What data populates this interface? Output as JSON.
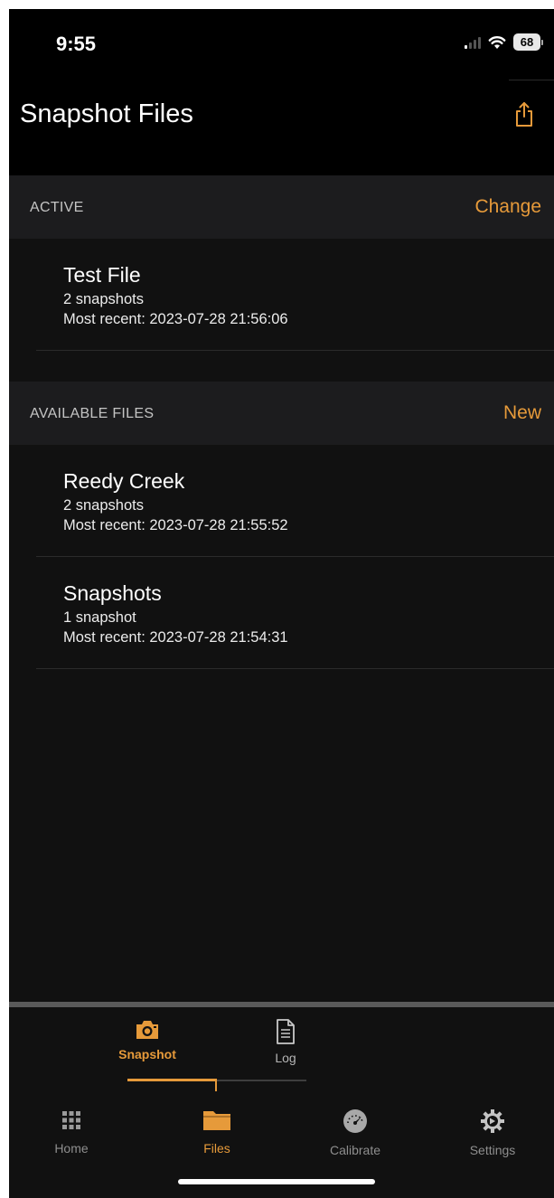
{
  "status_bar": {
    "time": "9:55",
    "battery_level": "68",
    "signal_icon": "cellular-signal-icon",
    "wifi_icon": "wifi-icon"
  },
  "header": {
    "title": "Snapshot Files",
    "share_icon": "share-icon"
  },
  "sections": {
    "active": {
      "label": "ACTIVE",
      "action": "Change",
      "items": [
        {
          "title": "Test File",
          "count": "2 snapshots",
          "recent": "Most recent: 2023-07-28 21:56:06"
        }
      ]
    },
    "available": {
      "label": "AVAILABLE FILES",
      "action": "New",
      "items": [
        {
          "title": "Reedy Creek",
          "count": "2 snapshots",
          "recent": "Most recent: 2023-07-28 21:55:52"
        },
        {
          "title": "Snapshots",
          "count": "1 snapshot",
          "recent": "Most recent: 2023-07-28 21:54:31"
        }
      ]
    }
  },
  "sub_tabs": [
    {
      "label": "Snapshot",
      "icon": "camera-icon",
      "active": true
    },
    {
      "label": "Log",
      "icon": "document-icon",
      "active": false
    }
  ],
  "tabs": [
    {
      "label": "Home",
      "icon": "grid-icon",
      "active": false
    },
    {
      "label": "Files",
      "icon": "folder-icon",
      "active": true
    },
    {
      "label": "Calibrate",
      "icon": "gauge-icon",
      "active": false
    },
    {
      "label": "Settings",
      "icon": "gear-icon",
      "active": false
    }
  ],
  "colors": {
    "accent": "#e69a3a",
    "background": "#000000",
    "section_background": "#1c1c1e",
    "list_background": "#111111"
  }
}
